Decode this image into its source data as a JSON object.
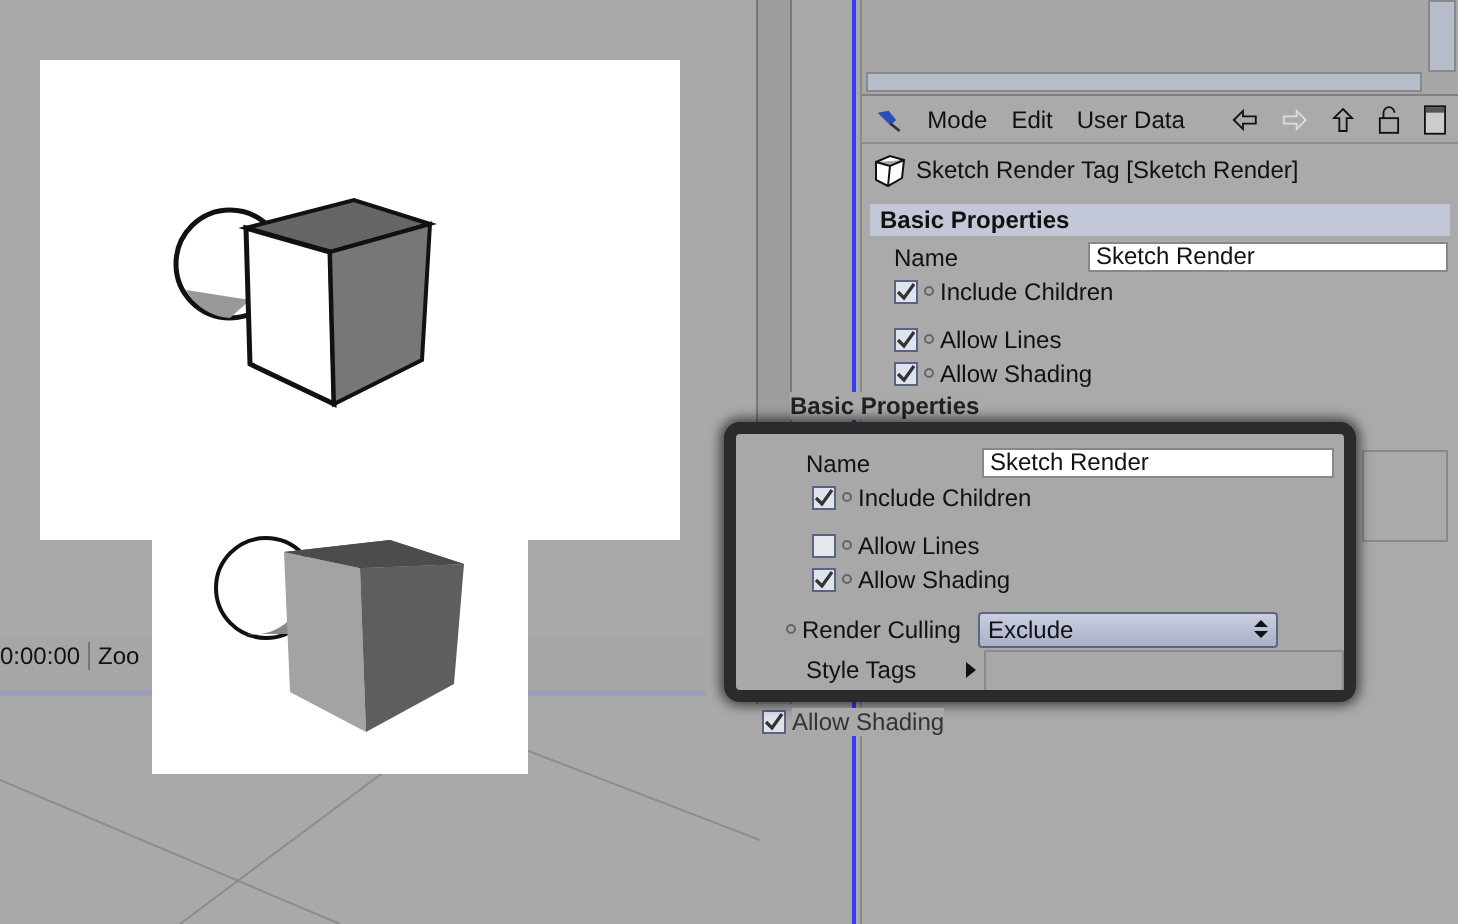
{
  "attribute_panel": {
    "menu": [
      {
        "label": "Mode"
      },
      {
        "label": "Edit"
      },
      {
        "label": "User Data"
      }
    ],
    "title": "Sketch Render Tag [Sketch Render]",
    "section": "Basic Properties",
    "name_label": "Name",
    "name_value": "Sketch Render",
    "options": [
      {
        "label": "Include Children",
        "checked": true
      },
      {
        "label": "Allow Lines",
        "checked": true
      },
      {
        "label": "Allow Shading",
        "checked": true
      }
    ]
  },
  "timeline": {
    "time": "0:00:00",
    "label": "Zoo"
  },
  "callout": {
    "section": "Basic Properties",
    "name_label": "Name",
    "name_value": "Sketch Render",
    "options": [
      {
        "label": "Include Children",
        "checked": true
      },
      {
        "label": "Allow Lines",
        "checked": false
      },
      {
        "label": "Allow Shading",
        "checked": true
      }
    ],
    "culling_label": "Render Culling",
    "culling_value": "Exclude",
    "style_tags_label": "Style Tags"
  },
  "behind_option": {
    "label": "Allow Shading",
    "checked": true
  }
}
